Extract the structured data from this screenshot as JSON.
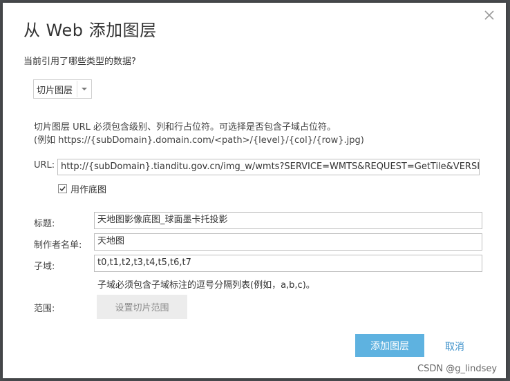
{
  "dialog": {
    "title": "从 Web 添加图层",
    "question": "当前引用了哪些类型的数据?",
    "data_type": {
      "selected": "切片图层"
    },
    "hint_line1": "切片图层 URL 必须包含级别、列和行占位符。可选择是否包含子域占位符。",
    "hint_line2": "(例如 https://{subDomain}.domain.com/<path>/{level}/{col}/{row}.jpg)",
    "url": {
      "label": "URL:",
      "value": "http://{subDomain}.tianditu.gov.cn/img_w/wmts?SERVICE=WMTS&REQUEST=GetTile&VERSIC"
    },
    "basemap_checkbox": {
      "label": "用作底图",
      "checked": true
    },
    "title_field": {
      "label": "标题:",
      "value": "天地图影像底图_球面墨卡托投影"
    },
    "author_field": {
      "label": "制作者名单:",
      "value": "天地图"
    },
    "subdomain_field": {
      "label": "子域:",
      "value": "t0,t1,t2,t3,t4,t5,t6,t7",
      "note": "子域必须包含子域标注的逗号分隔列表(例如，a,b,c)。"
    },
    "extent": {
      "label": "范围:",
      "button_label": "设置切片范围"
    },
    "add_button": "添加图层",
    "cancel_button": "取消"
  },
  "watermark": "CSDN @g_lindsey",
  "colors": {
    "primary": "#5eb2e0",
    "link": "#3a8fc9"
  },
  "icons": {
    "close": "close-icon",
    "dropdown": "chevron-down-icon",
    "check": "check-icon"
  }
}
